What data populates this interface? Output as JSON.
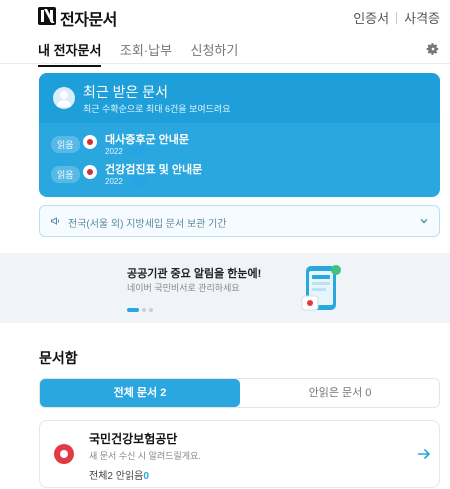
{
  "header": {
    "title": "전자문서",
    "links": [
      "인증서",
      "사격증"
    ]
  },
  "tabs": [
    {
      "label": "내 전자문서",
      "active": true
    },
    {
      "label": "조회·납부",
      "active": false
    },
    {
      "label": "신청하기",
      "active": false
    }
  ],
  "recent": {
    "title": "최근 받은 문서",
    "subtitle": "최근 수확순으로 최대 6건을 보여드려요",
    "documents": [
      {
        "badge": "읽음",
        "title": "대사증후군 안내문",
        "date": "2022"
      },
      {
        "badge": "읽음",
        "title": "건강검진표 및 안내문",
        "date": "2022"
      }
    ]
  },
  "notice": {
    "text": "전국(서울 외) 지방세입 문서 보관 기간"
  },
  "banner": {
    "title": "공공기관 중요 알림을 한눈에!",
    "subtitle": "네이버 국민비서로 관리하세요"
  },
  "inbox": {
    "heading": "문서함",
    "segments": {
      "all": "전체 문서 2",
      "unread": "안읽은 문서 0"
    },
    "org": {
      "name": "국민건강보험공단",
      "description": "새 문서 수신 시 알려드릴게요.",
      "total_label": "전체",
      "total": "2",
      "unread_label": "안읽음",
      "unread": "0"
    }
  },
  "colors": {
    "accent": "#2aa7df",
    "accent_dark": "#1f9fd9",
    "brand_red": "#e23a44"
  }
}
